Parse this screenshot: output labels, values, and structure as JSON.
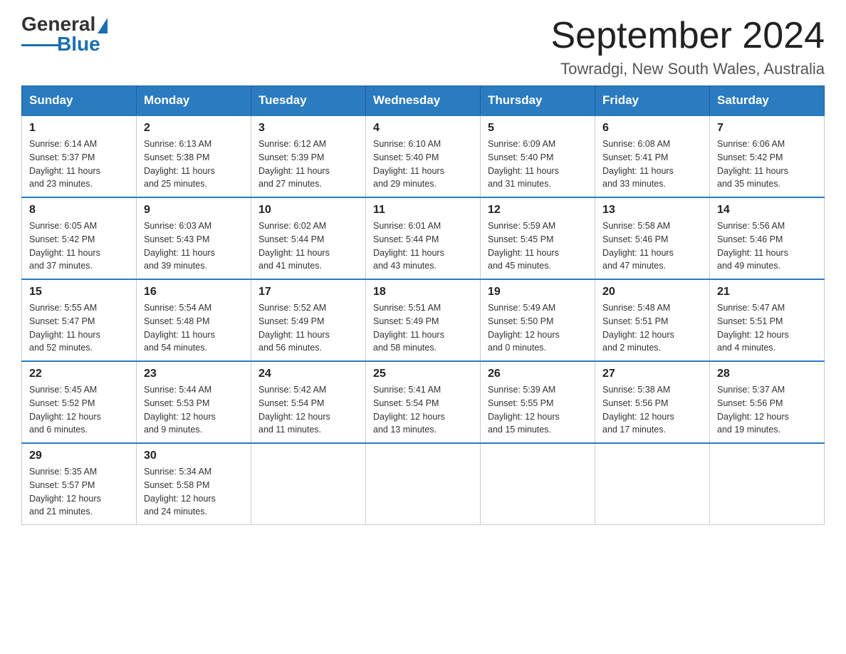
{
  "header": {
    "logo": {
      "general": "General",
      "blue": "Blue"
    },
    "title": "September 2024",
    "location": "Towradgi, New South Wales, Australia"
  },
  "days_of_week": [
    "Sunday",
    "Monday",
    "Tuesday",
    "Wednesday",
    "Thursday",
    "Friday",
    "Saturday"
  ],
  "weeks": [
    [
      {
        "day": "1",
        "sunrise": "6:14 AM",
        "sunset": "5:37 PM",
        "daylight": "11 hours and 23 minutes."
      },
      {
        "day": "2",
        "sunrise": "6:13 AM",
        "sunset": "5:38 PM",
        "daylight": "11 hours and 25 minutes."
      },
      {
        "day": "3",
        "sunrise": "6:12 AM",
        "sunset": "5:39 PM",
        "daylight": "11 hours and 27 minutes."
      },
      {
        "day": "4",
        "sunrise": "6:10 AM",
        "sunset": "5:40 PM",
        "daylight": "11 hours and 29 minutes."
      },
      {
        "day": "5",
        "sunrise": "6:09 AM",
        "sunset": "5:40 PM",
        "daylight": "11 hours and 31 minutes."
      },
      {
        "day": "6",
        "sunrise": "6:08 AM",
        "sunset": "5:41 PM",
        "daylight": "11 hours and 33 minutes."
      },
      {
        "day": "7",
        "sunrise": "6:06 AM",
        "sunset": "5:42 PM",
        "daylight": "11 hours and 35 minutes."
      }
    ],
    [
      {
        "day": "8",
        "sunrise": "6:05 AM",
        "sunset": "5:42 PM",
        "daylight": "11 hours and 37 minutes."
      },
      {
        "day": "9",
        "sunrise": "6:03 AM",
        "sunset": "5:43 PM",
        "daylight": "11 hours and 39 minutes."
      },
      {
        "day": "10",
        "sunrise": "6:02 AM",
        "sunset": "5:44 PM",
        "daylight": "11 hours and 41 minutes."
      },
      {
        "day": "11",
        "sunrise": "6:01 AM",
        "sunset": "5:44 PM",
        "daylight": "11 hours and 43 minutes."
      },
      {
        "day": "12",
        "sunrise": "5:59 AM",
        "sunset": "5:45 PM",
        "daylight": "11 hours and 45 minutes."
      },
      {
        "day": "13",
        "sunrise": "5:58 AM",
        "sunset": "5:46 PM",
        "daylight": "11 hours and 47 minutes."
      },
      {
        "day": "14",
        "sunrise": "5:56 AM",
        "sunset": "5:46 PM",
        "daylight": "11 hours and 49 minutes."
      }
    ],
    [
      {
        "day": "15",
        "sunrise": "5:55 AM",
        "sunset": "5:47 PM",
        "daylight": "11 hours and 52 minutes."
      },
      {
        "day": "16",
        "sunrise": "5:54 AM",
        "sunset": "5:48 PM",
        "daylight": "11 hours and 54 minutes."
      },
      {
        "day": "17",
        "sunrise": "5:52 AM",
        "sunset": "5:49 PM",
        "daylight": "11 hours and 56 minutes."
      },
      {
        "day": "18",
        "sunrise": "5:51 AM",
        "sunset": "5:49 PM",
        "daylight": "11 hours and 58 minutes."
      },
      {
        "day": "19",
        "sunrise": "5:49 AM",
        "sunset": "5:50 PM",
        "daylight": "12 hours and 0 minutes."
      },
      {
        "day": "20",
        "sunrise": "5:48 AM",
        "sunset": "5:51 PM",
        "daylight": "12 hours and 2 minutes."
      },
      {
        "day": "21",
        "sunrise": "5:47 AM",
        "sunset": "5:51 PM",
        "daylight": "12 hours and 4 minutes."
      }
    ],
    [
      {
        "day": "22",
        "sunrise": "5:45 AM",
        "sunset": "5:52 PM",
        "daylight": "12 hours and 6 minutes."
      },
      {
        "day": "23",
        "sunrise": "5:44 AM",
        "sunset": "5:53 PM",
        "daylight": "12 hours and 9 minutes."
      },
      {
        "day": "24",
        "sunrise": "5:42 AM",
        "sunset": "5:54 PM",
        "daylight": "12 hours and 11 minutes."
      },
      {
        "day": "25",
        "sunrise": "5:41 AM",
        "sunset": "5:54 PM",
        "daylight": "12 hours and 13 minutes."
      },
      {
        "day": "26",
        "sunrise": "5:39 AM",
        "sunset": "5:55 PM",
        "daylight": "12 hours and 15 minutes."
      },
      {
        "day": "27",
        "sunrise": "5:38 AM",
        "sunset": "5:56 PM",
        "daylight": "12 hours and 17 minutes."
      },
      {
        "day": "28",
        "sunrise": "5:37 AM",
        "sunset": "5:56 PM",
        "daylight": "12 hours and 19 minutes."
      }
    ],
    [
      {
        "day": "29",
        "sunrise": "5:35 AM",
        "sunset": "5:57 PM",
        "daylight": "12 hours and 21 minutes."
      },
      {
        "day": "30",
        "sunrise": "5:34 AM",
        "sunset": "5:58 PM",
        "daylight": "12 hours and 24 minutes."
      },
      null,
      null,
      null,
      null,
      null
    ]
  ],
  "labels": {
    "sunrise": "Sunrise:",
    "sunset": "Sunset:",
    "daylight": "Daylight:"
  }
}
